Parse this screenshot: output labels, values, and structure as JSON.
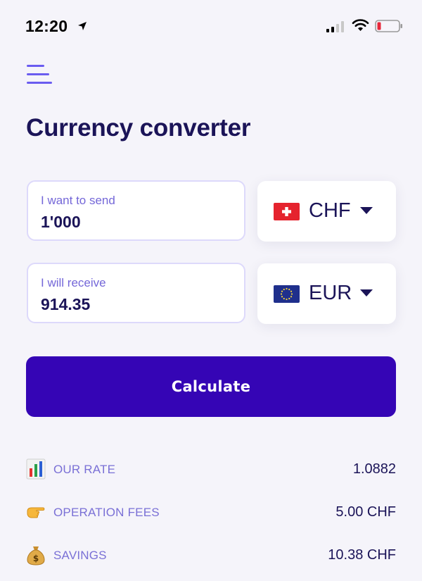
{
  "status_bar": {
    "time": "12:20",
    "battery_color": "#e6263a"
  },
  "app": {
    "title": "Currency converter",
    "accent_color": "#3505b5"
  },
  "send": {
    "label": "I want to send",
    "value": "1'000",
    "currency": {
      "code": "CHF",
      "flag_icon": "swiss-flag-icon"
    }
  },
  "receive": {
    "label": "I will receive",
    "value": "914.35",
    "currency": {
      "code": "EUR",
      "flag_icon": "eu-flag-icon"
    }
  },
  "calculate_button": {
    "label": "Calculate"
  },
  "info": {
    "rate": {
      "label": "OUR RATE",
      "value": "1.0882",
      "icon": "bar-chart-icon"
    },
    "fees": {
      "label": "OPERATION FEES",
      "value": "5.00 CHF",
      "icon": "pointing-hand-icon"
    },
    "savings": {
      "label": "SAVINGS",
      "value": "10.38 CHF",
      "icon": "money-bag-icon"
    }
  }
}
